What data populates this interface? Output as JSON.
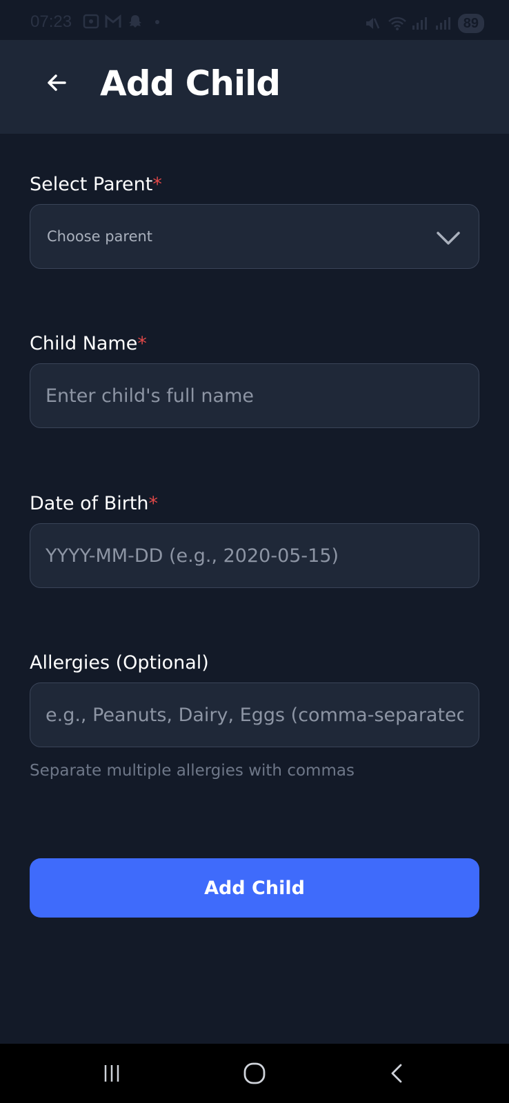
{
  "status_bar": {
    "time": "07:23",
    "battery": "89",
    "icons_left": [
      "screenshot-icon",
      "gmail-icon",
      "snapchat-icon",
      "dot-icon"
    ],
    "icons_right": [
      "mute-icon",
      "wifi-icon",
      "signal-icon",
      "signal-icon"
    ]
  },
  "header": {
    "back_icon": "arrow-left-icon",
    "title": "Add Child"
  },
  "form": {
    "parent": {
      "label": "Select Parent",
      "required_mark": "*",
      "placeholder": "Choose parent",
      "icon": "chevron-down-icon"
    },
    "child_name": {
      "label": "Child Name",
      "required_mark": "*",
      "placeholder": "Enter child's full name"
    },
    "dob": {
      "label": "Date of Birth",
      "required_mark": "*",
      "placeholder": "YYYY-MM-DD (e.g., 2020-05-15)"
    },
    "allergies": {
      "label": "Allergies (Optional)",
      "placeholder": "e.g., Peanuts, Dairy, Eggs (comma-separated)",
      "helper": "Separate multiple allergies with commas"
    },
    "submit_label": "Add Child"
  },
  "nav": {
    "recents_icon": "recents-icon",
    "home_icon": "home-icon",
    "back_icon": "back-chevron-icon"
  },
  "colors": {
    "background": "#131a28",
    "app_bar": "#1e2737",
    "input_bg": "#1f2838",
    "accent": "#3f6bfb",
    "required": "#e04848"
  }
}
